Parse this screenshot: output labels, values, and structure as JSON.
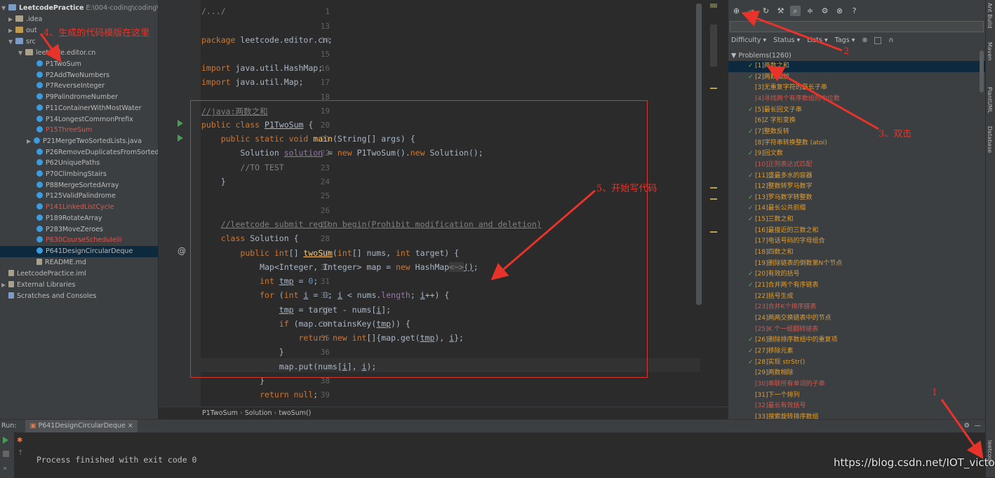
{
  "project": {
    "root_name": "LeetcodePractice",
    "root_path": "E:\\004-coding\\coding\\java\\",
    "idea": ".idea",
    "out": "out",
    "src": "src",
    "pkg": "leetcode.editor.cn",
    "files": [
      "P1TwoSum",
      "P2AddTwoNumbers",
      "P7ReverseInteger",
      "P9PalindromeNumber",
      "P11ContainerWithMostWater",
      "P14LongestCommonPrefix",
      "P15ThreeSum",
      "P21MergeTwoSortedLists.java",
      "P26RemoveDuplicatesFromSortedAr",
      "P62UniquePaths",
      "P70ClimbingStairs",
      "P88MergeSortedArray",
      "P125ValidPalindrome",
      "P141LinkedListCycle",
      "P189RotateArray",
      "P283MoveZeroes",
      "P630CourseScheduleIii",
      "P641DesignCircularDeque",
      "README.md"
    ],
    "iml": "LeetcodePractice.iml",
    "ext_libs": "External Libraries",
    "scratches": "Scratches and Consoles"
  },
  "editor": {
    "line_numbers": [
      "1",
      "13",
      "14",
      "15",
      "16",
      "17",
      "18",
      "19",
      "20",
      "21",
      "22",
      "23",
      "24",
      "25",
      "26",
      "27",
      "28",
      "29",
      "30",
      "31",
      "32",
      "33",
      "34",
      "35",
      "36",
      "37",
      "38",
      "39"
    ],
    "breadcrumb": [
      "P1TwoSum",
      "Solution",
      "twoSum()"
    ]
  },
  "leetcode_panel": {
    "filters": [
      "Difficulty",
      "Status",
      "Lists",
      "Tags"
    ],
    "root": "Problems(1260)",
    "problems": [
      {
        "t": "[1]两数之和",
        "s": "ok",
        "d": "ok"
      },
      {
        "t": "[2]两数相加",
        "s": "ok",
        "d": "ok"
      },
      {
        "t": "[3]无重复字符的最长子串",
        "s": "",
        "d": "ok"
      },
      {
        "t": "[4]寻找两个有序数组的中位数",
        "s": "",
        "d": "hard"
      },
      {
        "t": "[5]最长回文子串",
        "s": "ok",
        "d": "ok"
      },
      {
        "t": "[6]Z 字形变换",
        "s": "",
        "d": "ok"
      },
      {
        "t": "[7]整数反转",
        "s": "ok",
        "d": "ok"
      },
      {
        "t": "[8]字符串转换整数 (atoi)",
        "s": "",
        "d": "ok"
      },
      {
        "t": "[9]回文数",
        "s": "ok",
        "d": "ok"
      },
      {
        "t": "[10]正则表达式匹配",
        "s": "",
        "d": "hard"
      },
      {
        "t": "[11]盛最多水的容器",
        "s": "ok",
        "d": "ok"
      },
      {
        "t": "[12]整数转罗马数字",
        "s": "",
        "d": "ok"
      },
      {
        "t": "[13]罗马数字转整数",
        "s": "ok",
        "d": "ok"
      },
      {
        "t": "[14]最长公共前缀",
        "s": "ok",
        "d": "ok"
      },
      {
        "t": "[15]三数之和",
        "s": "ok",
        "d": "ok"
      },
      {
        "t": "[16]最接近的三数之和",
        "s": "",
        "d": "ok"
      },
      {
        "t": "[17]电话号码的字母组合",
        "s": "",
        "d": "ok"
      },
      {
        "t": "[18]四数之和",
        "s": "",
        "d": "ok"
      },
      {
        "t": "[19]删除链表的倒数第N个节点",
        "s": "",
        "d": "ok"
      },
      {
        "t": "[20]有效的括号",
        "s": "ok",
        "d": "ok"
      },
      {
        "t": "[21]合并两个有序链表",
        "s": "ok",
        "d": "ok"
      },
      {
        "t": "[22]括号生成",
        "s": "",
        "d": "ok"
      },
      {
        "t": "[23]合并K个排序链表",
        "s": "",
        "d": "hard"
      },
      {
        "t": "[24]两两交换链表中的节点",
        "s": "",
        "d": "ok"
      },
      {
        "t": "[25]K 个一组翻转链表",
        "s": "",
        "d": "hard"
      },
      {
        "t": "[26]删除排序数组中的重复项",
        "s": "ok",
        "d": "ok"
      },
      {
        "t": "[27]移除元素",
        "s": "ok",
        "d": "ok"
      },
      {
        "t": "[28]实现 strStr()",
        "s": "ok",
        "d": "ok"
      },
      {
        "t": "[29]两数相除",
        "s": "",
        "d": "ok"
      },
      {
        "t": "[30]串联所有单词的子串",
        "s": "",
        "d": "hard"
      },
      {
        "t": "[31]下一个排列",
        "s": "",
        "d": "ok"
      },
      {
        "t": "[32]最长有效括号",
        "s": "",
        "d": "hard"
      },
      {
        "t": "[33]搜索旋转排序数组",
        "s": "",
        "d": "ok"
      }
    ]
  },
  "side_tools": [
    "Ant Build",
    "Maven",
    "PlantUML",
    "Database",
    "leetcode"
  ],
  "run": {
    "label": "Run:",
    "tab": "P641DesignCircularDeque",
    "output": "Process finished with exit code 0"
  },
  "annotations": {
    "a1": "1",
    "a2": "2",
    "a3": "3、双击",
    "a4": "4、生成的代码模版在这里",
    "a5": "5、开始写代码"
  },
  "watermark": "https://blog.csdn.net/IOT_victor"
}
